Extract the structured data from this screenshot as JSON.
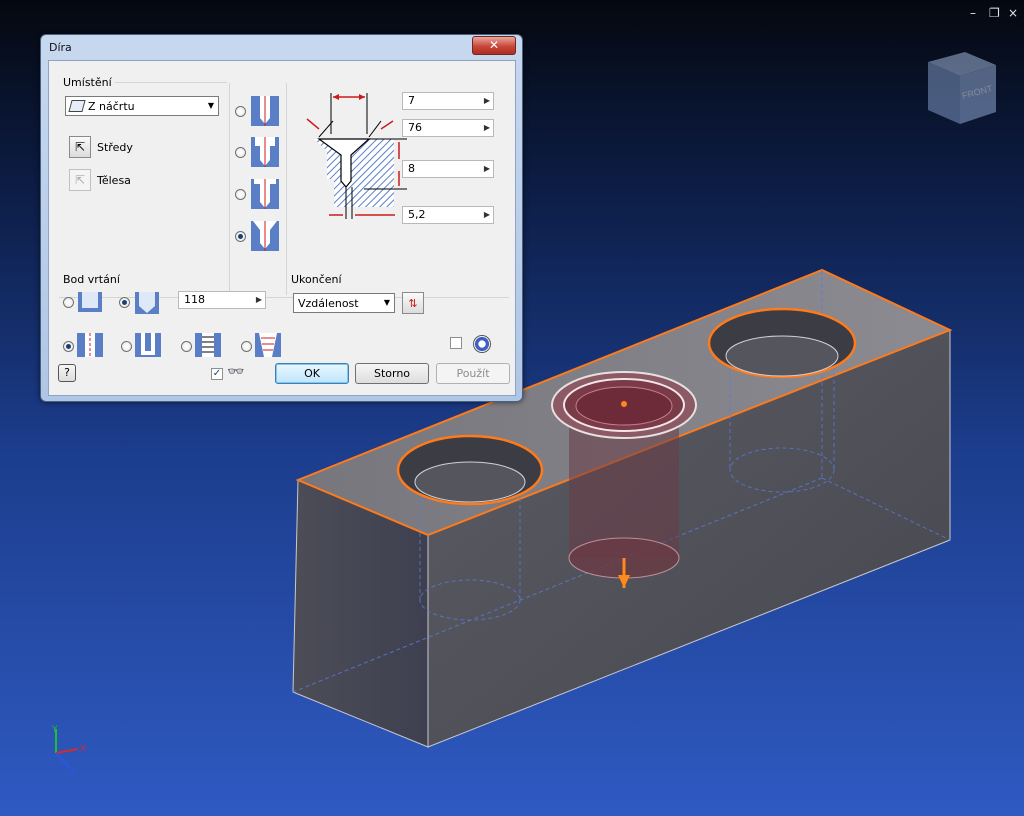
{
  "window_controls": {
    "minimize": "–",
    "restore": "❐",
    "close": "×"
  },
  "viewcube": {
    "face_label": "FRONT"
  },
  "dialog": {
    "title": "Díra",
    "close_symbol": "✕",
    "placement": {
      "group_label": "Umístění",
      "mode_value": "Z náčrtu",
      "centers_label": "Středy",
      "bodies_label": "Tělesa"
    },
    "dimensions": {
      "counterbore_diameter": "7",
      "countersink_angle": "76",
      "depth": "8",
      "hole_diameter": "5,2"
    },
    "drill_point": {
      "group_label": "Bod vrtání",
      "angle_value": "118"
    },
    "termination": {
      "group_label": "Ukončení",
      "value": "Vzdálenost"
    },
    "buttons": {
      "help": "?",
      "ok": "OK",
      "cancel": "Storno",
      "apply": "Použít"
    },
    "colors": {
      "accent_red": "#cc1b1b",
      "hatch_blue": "#5b7fc7"
    }
  },
  "axis_triad": {
    "x": "X",
    "y": "Y",
    "z": "Z"
  }
}
